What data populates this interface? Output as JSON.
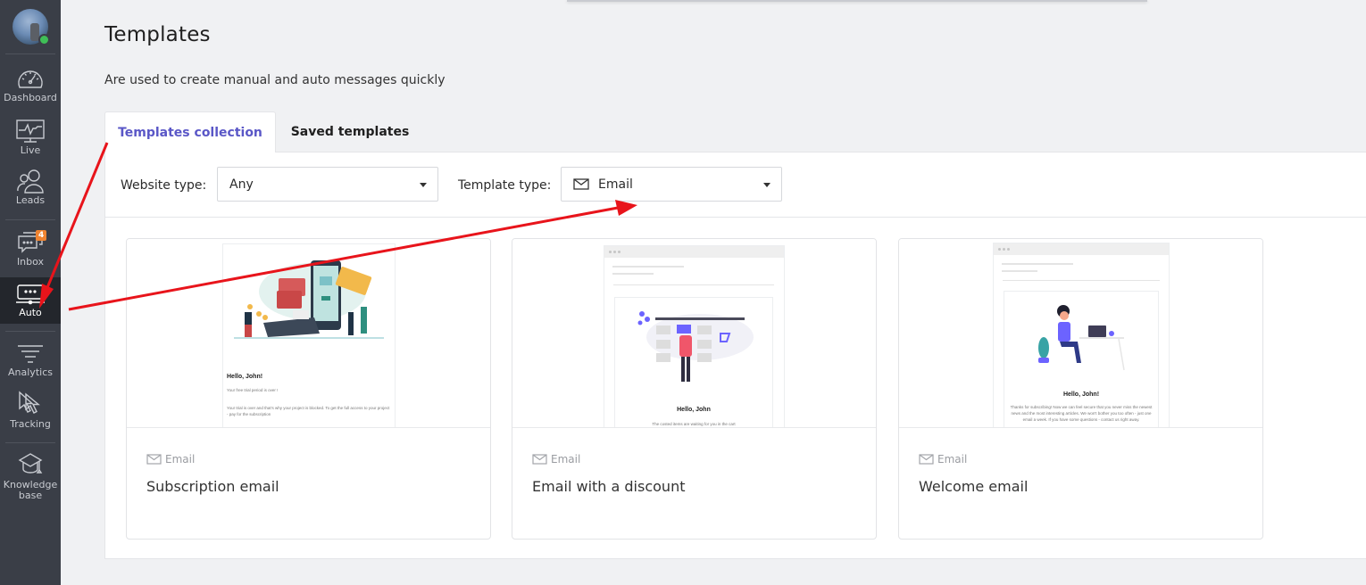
{
  "sidebar": {
    "avatar": {
      "status": "online"
    },
    "items": [
      {
        "label": "Dashboard",
        "icon": "dashboard-gauge-icon"
      },
      {
        "label": "Live",
        "icon": "monitor-pulse-icon"
      },
      {
        "label": "Leads",
        "icon": "users-icon"
      },
      {
        "label": "Inbox",
        "icon": "chat-bubbles-icon",
        "badge": "4"
      },
      {
        "label": "Auto",
        "icon": "auto-message-icon",
        "active": true
      },
      {
        "label": "Analytics",
        "icon": "funnel-lines-icon"
      },
      {
        "label": "Tracking",
        "icon": "cursors-icon"
      },
      {
        "label": "Knowledge base",
        "icon": "graduation-cap-icon"
      }
    ]
  },
  "header": {
    "title": "Templates",
    "subtitle": "Are used to create manual and auto messages quickly"
  },
  "tabs": [
    {
      "label": "Templates collection",
      "active": true
    },
    {
      "label": "Saved templates",
      "active": false
    }
  ],
  "filters": {
    "website_type": {
      "label": "Website type:",
      "value": "Any"
    },
    "template_type": {
      "label": "Template type:",
      "value": "Email",
      "icon": "envelope-icon"
    }
  },
  "cards": [
    {
      "type": "Email",
      "title": "Subscription email",
      "preview": {
        "greeting": "Hello, John!",
        "line1": "Your free trial period is over !",
        "line2": "Your trial is over and that's why your project is blocked. To get the full access to your project - pay for the subscription"
      }
    },
    {
      "type": "Email",
      "title": "Email with a discount",
      "preview": {
        "greeting": "Hello, John",
        "line1": "The costed items are waiting for you in the cart"
      }
    },
    {
      "type": "Email",
      "title": "Welcome email",
      "preview": {
        "greeting": "Hello, John!",
        "line1": "Thanks for subscribing! Now we can feel secure that you never miss the newest news and the most interesting articles. We won't bother you too often - just one email a week. If you have some questions - contact us right away."
      }
    }
  ],
  "colors": {
    "accent": "#5a57c7",
    "sidebar_bg": "#3a3e47",
    "sidebar_active": "#23262c",
    "badge": "#f08431",
    "online": "#3fbf57",
    "annotation": "#e8141b"
  }
}
